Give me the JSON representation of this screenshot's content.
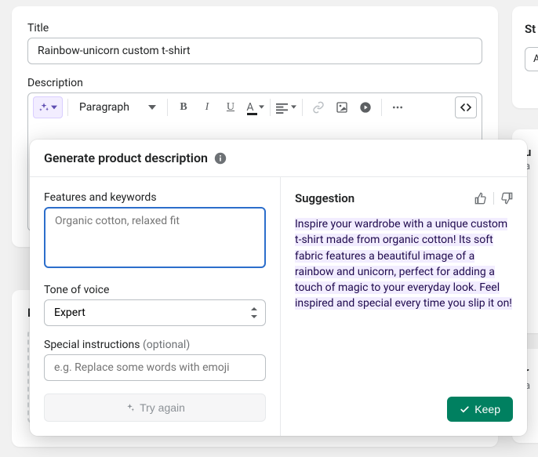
{
  "title_section": {
    "label": "Title",
    "value": "Rainbow-unicorn custom t-shirt"
  },
  "description_section": {
    "label": "Description"
  },
  "toolbar": {
    "paragraph_label": "Paragraph"
  },
  "side": {
    "st_label": "St",
    "box_label": "A",
    "u_label": "u",
    "a_label": "a",
    "r_label": "r",
    "a2_label": "a"
  },
  "low": {
    "m_label": "M"
  },
  "popover": {
    "header": "Generate product description",
    "features_label": "Features and keywords",
    "features_placeholder": "Organic cotton, relaxed fit",
    "tone_label": "Tone of voice",
    "tone_value": "Expert",
    "special_label": "Special instructions",
    "special_optional": "(optional)",
    "special_placeholder": "e.g. Replace some words with emoji",
    "try_again_label": "Try again",
    "suggestion_label": "Suggestion",
    "suggestion_text": "Inspire your wardrobe with a unique custom t-shirt made from organic cotton! Its soft fabric features a beautiful image of a rainbow and unicorn, perfect for adding a touch of magic to your everyday look. Feel inspired and special every time you slip it on!",
    "keep_label": "Keep"
  }
}
